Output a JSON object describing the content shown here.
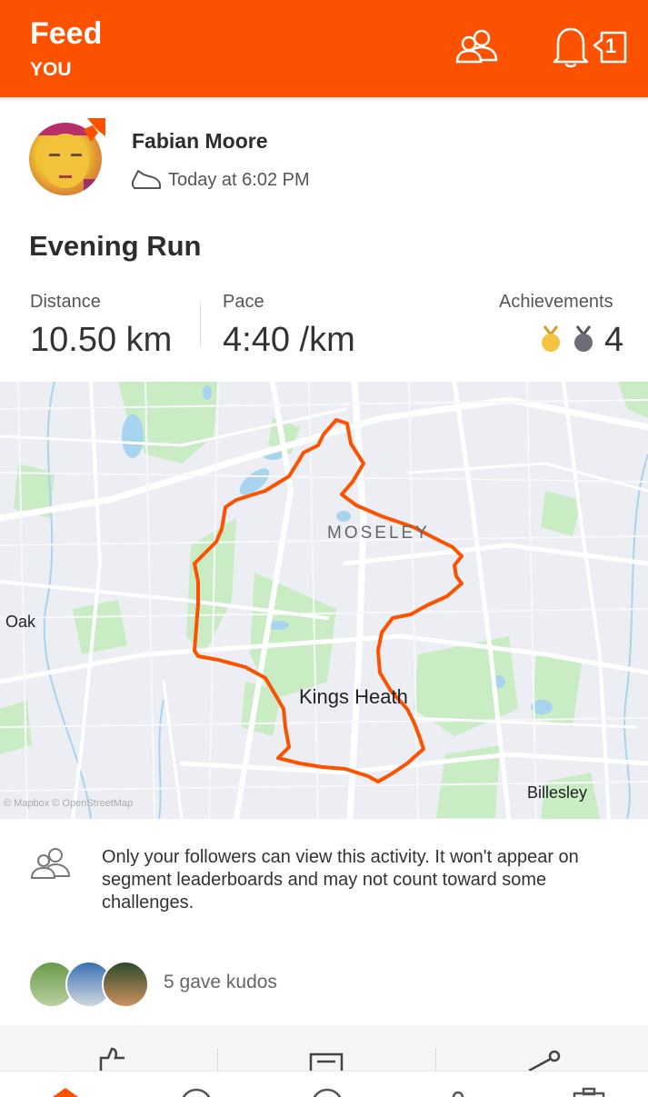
{
  "header": {
    "title": "Feed",
    "subtitle": "YOU",
    "notification_count": "1"
  },
  "activity": {
    "athlete_name": "Fabian Moore",
    "timestamp": "Today at 6:02 PM",
    "title": "Evening Run",
    "stats": {
      "distance_label": "Distance",
      "distance_value": "10.50 km",
      "pace_label": "Pace",
      "pace_value": "4:40 /km",
      "achievements_label": "Achievements",
      "achievements_value": "4"
    },
    "map": {
      "labels": {
        "moseley": "MOSELEY",
        "kings_heath": "Kings Heath",
        "billesley": "Billesley",
        "oak": "Oak"
      },
      "attribution": "© Mapbox © OpenStreetMap"
    },
    "privacy_notice": "Only your followers can view this activity. It won't appear on segment leaderboards and may not count toward some challenges.",
    "kudos_text": "5 gave kudos"
  },
  "colors": {
    "brand": "#fc5200",
    "route": "#fc5200",
    "gold_medal": "#f5c342",
    "silver_medal": "#6d6d78"
  }
}
